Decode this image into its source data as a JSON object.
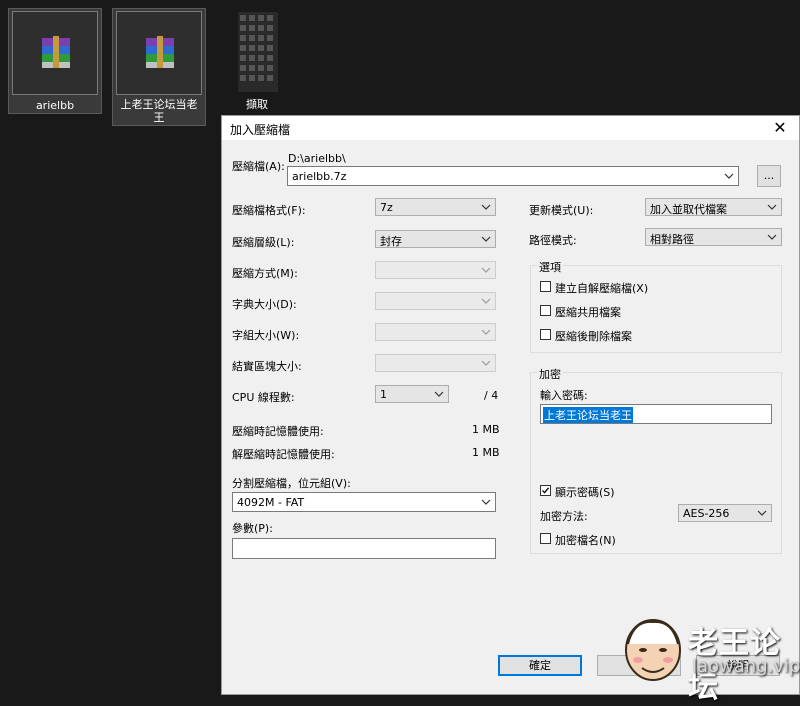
{
  "desktop": {
    "icons": [
      {
        "label": "arielbb"
      },
      {
        "label": "上老王论坛当老王"
      },
      {
        "label": "擷取"
      }
    ]
  },
  "dialog": {
    "title": "加入壓縮檔",
    "close_glyph": "✕",
    "archive_label": "壓縮檔(A):",
    "archive_path": "D:\\arielbb\\",
    "archive_name": "arielbb.7z",
    "browse_label": "...",
    "left": {
      "format_label": "壓縮檔格式(F):",
      "format_value": "7z",
      "level_label": "壓縮層級(L):",
      "level_value": "封存",
      "method_label": "壓縮方式(M):",
      "dict_label": "字典大小(D):",
      "word_label": "字組大小(W):",
      "solid_label": "結實區塊大小:",
      "cpu_label": "CPU 線程數:",
      "cpu_value": "1",
      "cpu_total": "/ 4",
      "mem_comp_label": "壓縮時記憶體使用:",
      "mem_comp_value": "1 MB",
      "mem_decomp_label": "解壓縮時記憶體使用:",
      "mem_decomp_value": "1 MB",
      "split_label": "分割壓縮檔，位元組(V):",
      "split_value": "4092M - FAT",
      "params_label": "參數(P):",
      "params_value": ""
    },
    "right": {
      "update_label": "更新模式(U):",
      "update_value": "加入並取代檔案",
      "path_label": "路徑模式:",
      "path_value": "相對路徑",
      "options_group": "選項",
      "opt_sfx": "建立自解壓縮檔(X)",
      "opt_shared": "壓縮共用檔案",
      "opt_delete": "壓縮後刪除檔案",
      "encrypt_group": "加密",
      "password_label": "輸入密碼:",
      "password_value": "上老王论坛当老王",
      "show_password": "顯示密碼(S)",
      "enc_method_label": "加密方法:",
      "enc_method_value": "AES-256",
      "enc_names": "加密檔名(N)"
    },
    "buttons": {
      "ok": "確定",
      "cancel": "取",
      "help": "說明"
    }
  },
  "watermark": {
    "brand": "老王论坛",
    "url": "laowang.vip"
  },
  "colors": {
    "desktop_bg": "#191919",
    "dialog_bg": "#f0f0f0",
    "accent": "#0078d7"
  }
}
